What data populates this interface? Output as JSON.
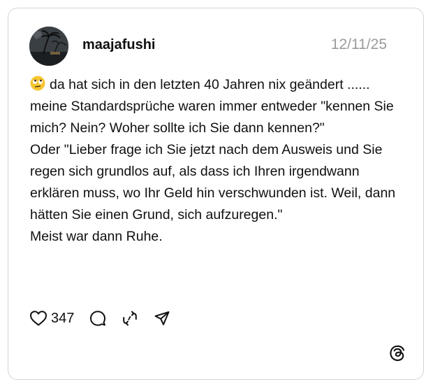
{
  "post": {
    "username": "maajafushi",
    "date": "12/11/25",
    "emoji": "🙄",
    "text_lines": [
      "da hat sich in den letzten 40 Jahren nix geändert ...... meine Standardsprüche waren immer entweder \"kennen Sie mich? Nein? Woher sollte ich Sie dann kennen?\"",
      "Oder \"Lieber frage ich Sie jetzt nach dem Ausweis und Sie regen sich grundlos auf, als dass ich Ihren irgendwann erklären muss, wo Ihr Geld hin verschwunden ist. Weil, dann hätten Sie einen Grund, sich aufzuregen.\"",
      "Meist war dann Ruhe."
    ]
  },
  "actions": {
    "like_count": "347",
    "icons": [
      "heart-icon",
      "comment-icon",
      "repost-icon",
      "share-icon"
    ]
  },
  "brand": {
    "logo": "threads-logo-icon"
  },
  "colors": {
    "text": "#101010",
    "muted": "#9a9a9a",
    "border": "#d4d4d4"
  }
}
